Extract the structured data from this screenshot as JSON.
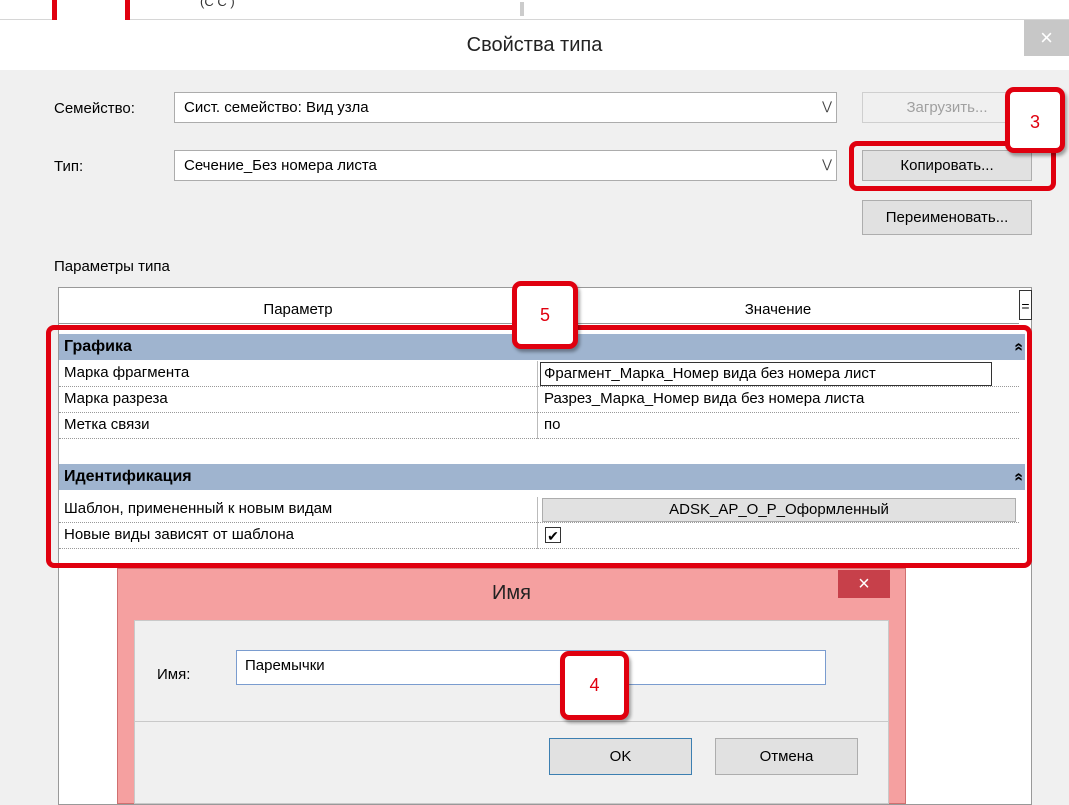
{
  "background": {
    "partial_text": "(С      С             )"
  },
  "dialog": {
    "title": "Свойства типа",
    "close_glyph": "×",
    "family_label": "Семейство:",
    "family_value": "Сист. семейство: Вид узла",
    "type_label": "Тип:",
    "type_value": "Сечение_Без номера листа",
    "load_button": "Загрузить...",
    "copy_button": "Копировать...",
    "rename_button": "Переименовать...",
    "params_label": "Параметры типа",
    "col_param": "Параметр",
    "col_value": "Значение",
    "col_eq": "="
  },
  "sections": [
    {
      "name": "Графика",
      "collapse": "«"
    },
    {
      "name": "Идентификация",
      "collapse": "«"
    }
  ],
  "rows": [
    {
      "param": "Марка фрагмента",
      "value": "Фрагмент_Марка_Номер вида без номера лист"
    },
    {
      "param": "Марка разреза",
      "value": "Разрез_Марка_Номер вида без номера листа"
    },
    {
      "param": "Метка связи",
      "value": "по"
    },
    {
      "param": "Шаблон, примененный к новым видам",
      "value": "ADSK_AP_O_P_Оформленный"
    },
    {
      "param": "Новые виды зависят от шаблона",
      "value": "✔"
    }
  ],
  "name_dialog": {
    "title": "Имя",
    "close_glyph": "×",
    "name_label": "Имя:",
    "name_value": "Паремычки",
    "ok_button": "OK",
    "cancel_button": "Отмена"
  },
  "badges": {
    "b3": "3",
    "b4": "4",
    "b5": "5"
  },
  "colors": {
    "highlight_red": "#e0000f",
    "section_blue": "#9fb4cf",
    "name_dialog_pink": "#f5a0a0"
  }
}
